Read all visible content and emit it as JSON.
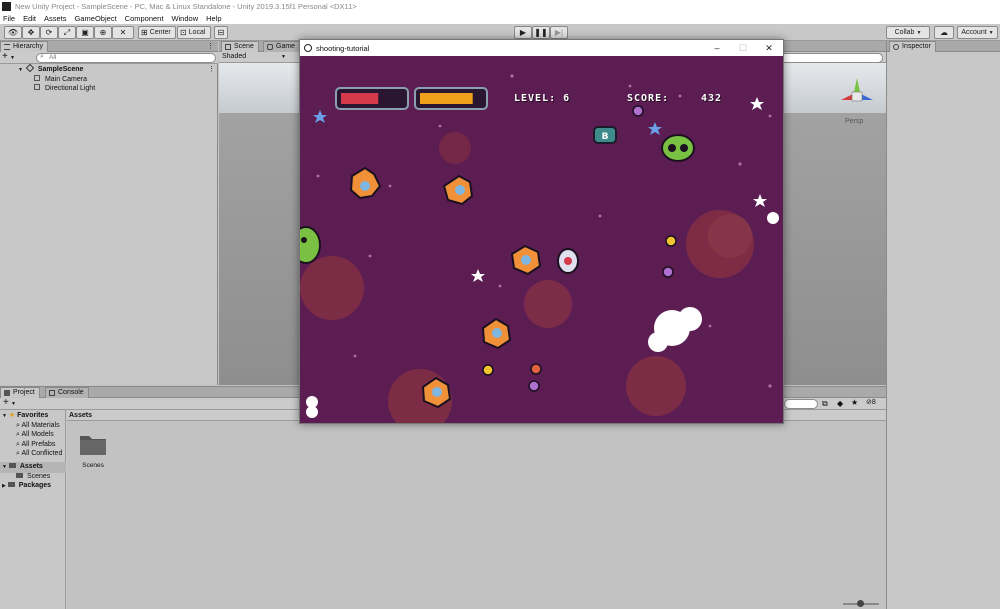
{
  "window": {
    "title": "New Unity Project - SampleScene - PC, Mac & Linux Standalone - Unity 2019.3.15f1 Personal <DX11>"
  },
  "menu": [
    "File",
    "Edit",
    "Assets",
    "GameObject",
    "Component",
    "Window",
    "Help"
  ],
  "toolbar": {
    "pivot_label": "Center",
    "space_label": "Local",
    "collab_label": "Collab",
    "account_label": "Account"
  },
  "hierarchy": {
    "tab": "Hierarchy",
    "search_placeholder": "All",
    "scene_name": "SampleScene",
    "objects": [
      "Main Camera",
      "Directional Light"
    ]
  },
  "scene_view": {
    "tabs": [
      "Scene",
      "Game"
    ],
    "shading_mode": "Shaded",
    "persp_label": "Persp"
  },
  "inspector": {
    "tab": "Inspector"
  },
  "project": {
    "tabs": [
      "Project",
      "Console"
    ],
    "favorites_label": "Favorites",
    "favorites": [
      "All Materials",
      "All Models",
      "All Prefabs",
      "All Conflicted"
    ],
    "assets_label": "Assets",
    "asset_children": [
      "Scenes"
    ],
    "packages_label": "Packages",
    "breadcrumb": "Assets",
    "folders": [
      "Scenes"
    ],
    "hidden_count": "8"
  },
  "game_window": {
    "title": "shooting-tutorial",
    "level_label": "LEVEL: 6",
    "score_label": "SCORE:",
    "score_value": "432",
    "health_fraction": 0.6,
    "energy_fraction": 0.85,
    "colors": {
      "background": "#5c1d53",
      "health": "#d63a4a",
      "energy": "#f1a01c"
    }
  }
}
